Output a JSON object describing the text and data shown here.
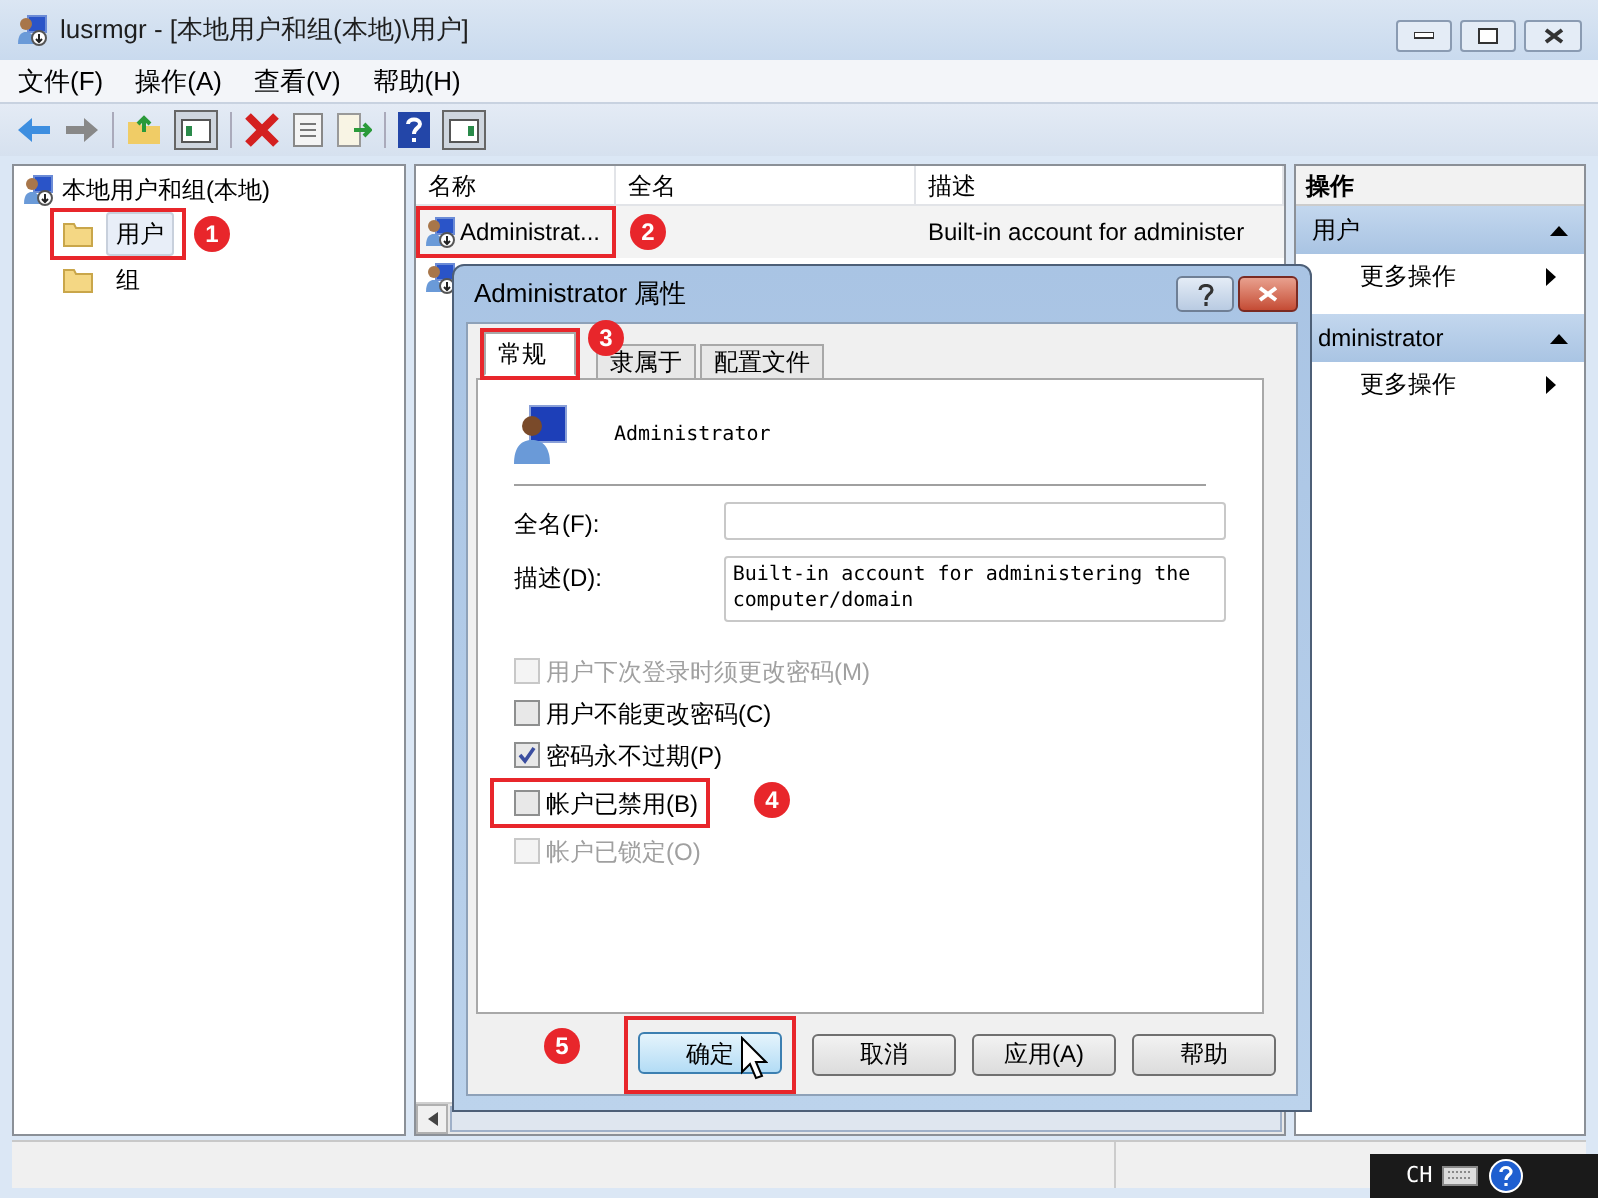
{
  "window": {
    "title": "lusrmgr - [本地用户和组(本地)\\用户]"
  },
  "menu": [
    "文件(F)",
    "操作(A)",
    "查看(V)",
    "帮助(H)"
  ],
  "tree": {
    "root": "本地用户和组(本地)",
    "children": [
      {
        "label": "用户",
        "selected": true,
        "callout": "1"
      },
      {
        "label": "组",
        "selected": false
      }
    ]
  },
  "list": {
    "columns": [
      "名称",
      "全名",
      "描述"
    ],
    "rows": [
      {
        "name": "Administrat...",
        "description": "Built-in account for administer",
        "callout": "2"
      }
    ]
  },
  "actions": {
    "header": "操作",
    "groups": [
      {
        "title": "用户",
        "items": [
          "更多操作"
        ]
      },
      {
        "title": "dministrator",
        "items": [
          "更多操作"
        ]
      }
    ]
  },
  "dialog": {
    "title": "Administrator 属性",
    "tabs": [
      {
        "label": "常规",
        "selected": true,
        "callout": "3"
      },
      {
        "label": "隶属于",
        "selected": false
      },
      {
        "label": "配置文件",
        "selected": false
      }
    ],
    "user": "Administrator",
    "fields": [
      {
        "label": "全名(F):"
      },
      {
        "label": "描述(D):",
        "value": "Built-in account for administering the computer/domain"
      }
    ],
    "checkboxes": [
      {
        "label": "用户下次登录时须更改密码(M)",
        "checked": false,
        "disabled": true
      },
      {
        "label": "用户不能更改密码(C)",
        "checked": false,
        "disabled": false
      },
      {
        "label": "密码永不过期(P)",
        "checked": true,
        "disabled": false
      },
      {
        "label": "帐户已禁用(B)",
        "checked": false,
        "disabled": false,
        "callout": "4"
      },
      {
        "label": "帐户已锁定(O)",
        "checked": false,
        "disabled": true
      }
    ],
    "buttons": [
      {
        "label": "确定",
        "kind": "default",
        "callout": "5"
      },
      {
        "label": "取消",
        "kind": "normal"
      },
      {
        "label": "应用(A)",
        "kind": "normal"
      },
      {
        "label": "帮助",
        "kind": "normal"
      }
    ]
  },
  "tray": {
    "language": "CH"
  }
}
